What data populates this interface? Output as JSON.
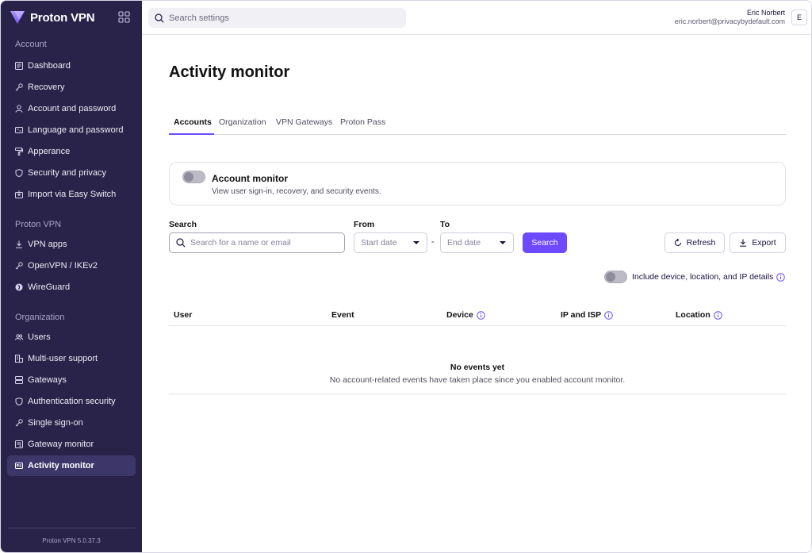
{
  "brand": {
    "name": "Proton VPN"
  },
  "sidebar": {
    "sections": [
      {
        "title": "Account"
      },
      {
        "title": "Proton VPN"
      },
      {
        "title": "Organization"
      }
    ],
    "items": [
      {
        "label": "Dashboard"
      },
      {
        "label": "Recovery"
      },
      {
        "label": "Account and password"
      },
      {
        "label": "Language and password"
      },
      {
        "label": "Apperance"
      },
      {
        "label": "Security and privacy"
      },
      {
        "label": "Import via Easy Switch"
      },
      {
        "label": "VPN apps"
      },
      {
        "label": "OpenVPN / IKEv2"
      },
      {
        "label": "WireGuard"
      },
      {
        "label": "Users"
      },
      {
        "label": "Multi-user support"
      },
      {
        "label": "Gateways"
      },
      {
        "label": "Authentication security"
      },
      {
        "label": "Single sign-on"
      },
      {
        "label": "Gateway monitor"
      },
      {
        "label": "Activity monitor"
      }
    ],
    "version": "Proton VPN 5.0.37.3"
  },
  "topbar": {
    "search_placeholder": "Search settings",
    "user_name": "Eric Norbert",
    "user_email": "eric.norbert@privacybydefault.com",
    "avatar_initial": "E"
  },
  "main": {
    "title": "Activity monitor",
    "tabs": [
      {
        "label": "Accounts"
      },
      {
        "label": "Organization"
      },
      {
        "label": "VPN Gateways"
      },
      {
        "label": "Proton Pass"
      }
    ],
    "monitor_card": {
      "title": "Account monitor",
      "description": "View user sign-in, recovery, and security events."
    },
    "filters": {
      "search_label": "Search",
      "search_placeholder": "Search for a name or email",
      "from_label": "From",
      "from_placeholder": "Start date",
      "to_label": "To",
      "to_placeholder": "End date",
      "separator": "-",
      "search_button": "Search",
      "refresh_button": "Refresh",
      "export_button": "Export"
    },
    "details_toggle_label": "Include device, location, and IP details",
    "table": {
      "columns": [
        "User",
        "Event",
        "Device",
        "IP and ISP",
        "Location"
      ],
      "empty_title": "No events yet",
      "empty_description": "No account-related events have taken place since you enabled account monitor."
    }
  },
  "colors": {
    "sidebar_bg": "#29234a",
    "accent": "#6d4aff",
    "active_item_bg": "#3d3668"
  }
}
